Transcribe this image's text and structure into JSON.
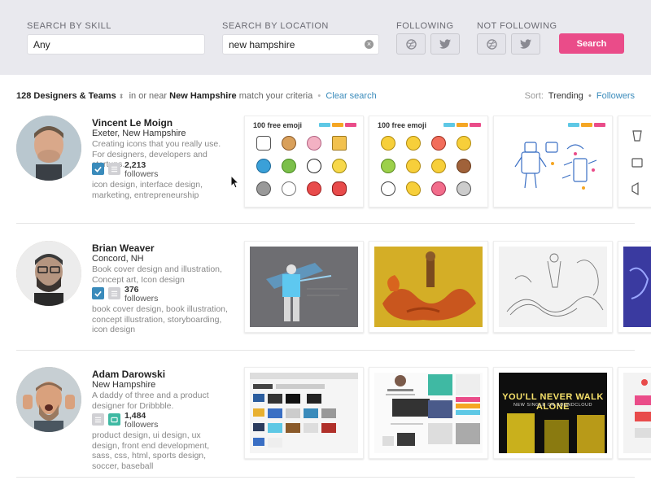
{
  "filters": {
    "skill_label": "SEARCH BY SKILL",
    "skill_value": "Any",
    "location_label": "SEARCH BY LOCATION",
    "location_value": "new hampshire",
    "following_label": "FOLLOWING",
    "not_following_label": "NOT FOLLOWING",
    "search_button": "Search"
  },
  "summary": {
    "count": "128 Designers & Teams",
    "middle": "in or near",
    "place": "New Hampshire",
    "tail": "match your criteria",
    "sep": "•",
    "clear": "Clear search"
  },
  "sort": {
    "label": "Sort:",
    "active": "Trending",
    "sep": "•",
    "other": "Followers"
  },
  "designers": [
    {
      "name": "Vincent Le Moign",
      "location": "Exeter, New Hampshire",
      "bio": "Creating icons that you really use. For designers, developers and startups.",
      "followers": "2,213",
      "followers_label": "followers",
      "skills": "icon design, interface design, marketing, entrepreneurship",
      "emoji_title": "100 free emoji"
    },
    {
      "name": "Brian Weaver",
      "location": "Concord, NH",
      "bio": "Book cover design and illustration, Concept art, Icon design",
      "followers": "376",
      "followers_label": "followers",
      "skills": "book cover design, book illustration, concept illustration, storyboarding, icon design"
    },
    {
      "name": "Adam Darowski",
      "location": "New Hampshire",
      "bio": "A daddy of three and a product designer for Dribbble.",
      "followers": "1,484",
      "followers_label": "followers",
      "skills": "product design, ui design, ux design, front end development, sass, css, html, sports design, soccer, baseball",
      "banner_title": "YOU'LL NEVER WALK ALONE",
      "banner_sub": "NEW SINGLE ON SOUNDCLOUD"
    }
  ],
  "colors": {
    "accent_pink": "#ea4c89",
    "link_blue": "#3a8bbb",
    "list_green": "#3fb9a3",
    "filter_bg": "#e9e9ee"
  }
}
